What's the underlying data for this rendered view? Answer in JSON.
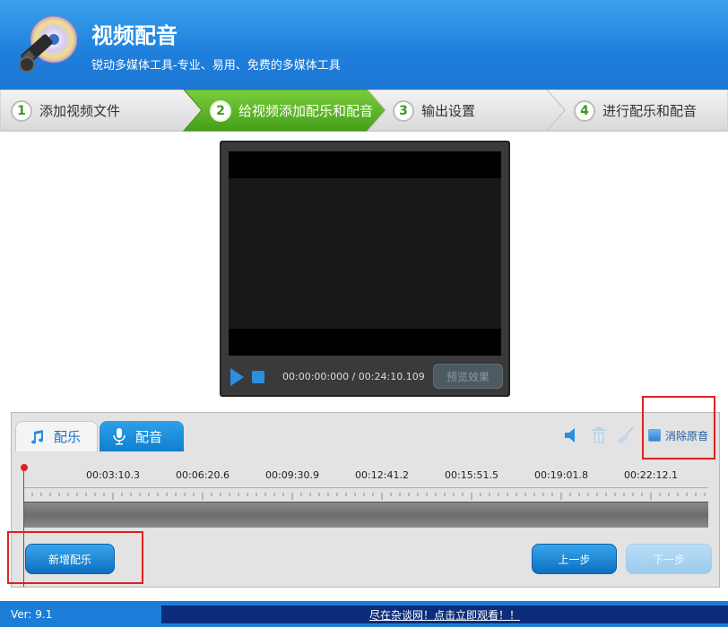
{
  "header": {
    "title": "视频配音",
    "subtitle": "锐动多媒体工具-专业、易用、免费的多媒体工具",
    "logo_icon": "film-cd-icon"
  },
  "steps": [
    {
      "num": "1",
      "label": "添加视频文件",
      "active": false
    },
    {
      "num": "2",
      "label": "给视频添加配乐和配音",
      "active": true
    },
    {
      "num": "3",
      "label": "输出设置",
      "active": false
    },
    {
      "num": "4",
      "label": "进行配乐和配音",
      "active": false
    }
  ],
  "player": {
    "time": "00:00:00:000 / 00:24:10.109",
    "preview_label": "预览效果"
  },
  "panel": {
    "tab_music": "配乐",
    "tab_dub": "配音",
    "mute_original_label": "消除原音",
    "timeline_labels": [
      "00:03:10.3",
      "00:06:20.6",
      "00:09:30.9",
      "00:12:41.2",
      "00:15:51.5",
      "00:19:01.8",
      "00:22:12.1"
    ],
    "add_music_label": "新增配乐",
    "prev_label": "上一步",
    "next_label": "下一步"
  },
  "status": {
    "version": "Ver: 9.1",
    "promo": "尽在杂谈网！点击立即观看！！"
  },
  "colors": {
    "header_blue": "#1f7fdc",
    "active_step_green": "#58b82a",
    "highlight_red": "#e02020"
  }
}
